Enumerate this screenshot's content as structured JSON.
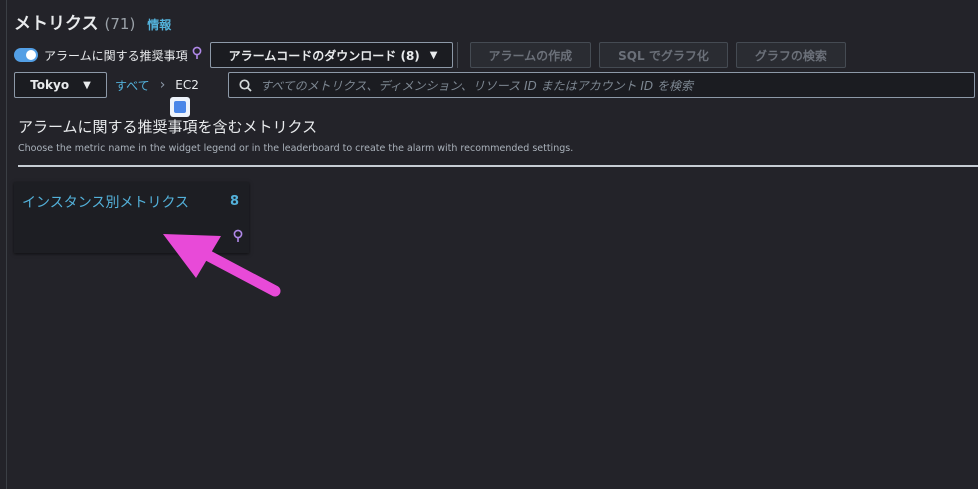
{
  "header": {
    "title": "メトリクス",
    "count": "(71)",
    "info": "情報"
  },
  "toolbar": {
    "toggle_label": "アラームに関する推奨事項",
    "download_label": "アラームコードのダウンロード (8)",
    "create_alarm_label": "アラームの作成",
    "sql_graph_label": "SQL でグラフ化",
    "graph_search_label": "グラフの検索"
  },
  "filter": {
    "region": "Tokyo",
    "breadcrumb": [
      "すべて",
      "EC2"
    ],
    "search_placeholder": "すべてのメトリクス、ディメンション、リソース ID またはアカウント ID を検索"
  },
  "section": {
    "title": "アラームに関する推奨事項を含むメトリクス",
    "description": "Choose the metric name in the widget legend or in the leaderboard to create the alarm with recommended settings."
  },
  "card": {
    "title": "インスタンス別メトリクス",
    "count": "8"
  },
  "colors": {
    "accent": "#53b1da",
    "background": "#232329",
    "arrow": "#e84ad8",
    "bulb": "#b088e8"
  },
  "icons": [
    "toggle-switch",
    "lightbulb-icon",
    "caret-down-icon",
    "chevron-right-icon",
    "search-icon",
    "translate-icon",
    "arrow-annotation"
  ]
}
